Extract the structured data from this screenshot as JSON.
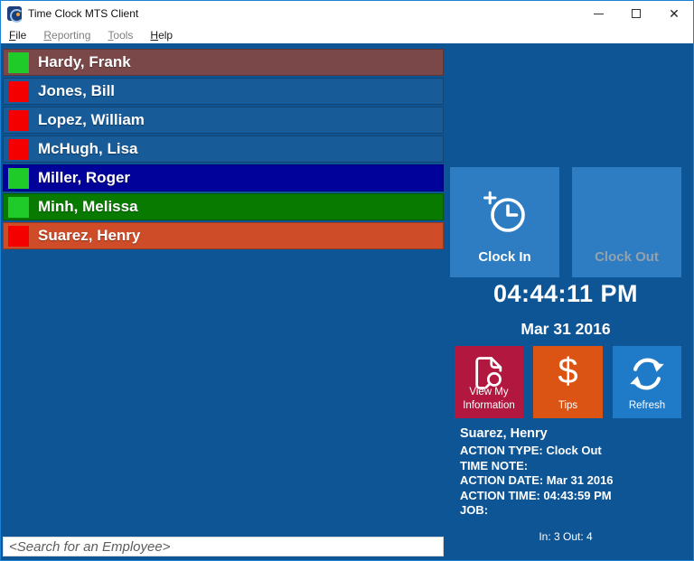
{
  "window": {
    "title": "Time Clock MTS Client",
    "controls": {
      "minimize": "minimize",
      "maximize": "maximize",
      "close": "close"
    }
  },
  "menu": {
    "items": [
      {
        "label": "File",
        "enabled": true
      },
      {
        "label": "Reporting",
        "enabled": false
      },
      {
        "label": "Tools",
        "enabled": false
      },
      {
        "label": "Help",
        "enabled": true
      }
    ]
  },
  "employees": [
    {
      "name": "Hardy, Frank",
      "status": "in",
      "indicator_color": "#1ECB29",
      "row_color": "#7A4848"
    },
    {
      "name": "Jones, Bill",
      "status": "out",
      "indicator_color": "#F40000",
      "row_color": "#175B99"
    },
    {
      "name": "Lopez, William",
      "status": "out",
      "indicator_color": "#F40000",
      "row_color": "#175B99"
    },
    {
      "name": "McHugh, Lisa",
      "status": "out",
      "indicator_color": "#F40000",
      "row_color": "#175B99"
    },
    {
      "name": "Miller, Roger",
      "status": "in",
      "indicator_color": "#1ECB29",
      "row_color": "#000299"
    },
    {
      "name": "Minh, Melissa",
      "status": "in",
      "indicator_color": "#1ECB29",
      "row_color": "#087A00"
    },
    {
      "name": "Suarez, Henry",
      "status": "out",
      "indicator_color": "#F40000",
      "row_color": "#CE4C28"
    }
  ],
  "actions": {
    "clock_in_label": "Clock In",
    "clock_out_label": "Clock Out",
    "clock_out_enabled": false
  },
  "clock": {
    "time": "04:44:11 PM",
    "date": "Mar 31 2016"
  },
  "tiles": [
    {
      "label": "View My Information",
      "color": "#B2173F",
      "icon": "document-search-icon"
    },
    {
      "label": "Tips",
      "color": "#DC5414",
      "icon": "dollar-icon"
    },
    {
      "label": "Refresh",
      "color": "#1F7AC8",
      "icon": "refresh-icon"
    }
  ],
  "last_action": {
    "employee": "Suarez, Henry",
    "lines": [
      "ACTION TYPE: Clock Out",
      "TIME NOTE:",
      "ACTION DATE: Mar 31 2016",
      "ACTION TIME: 04:43:59 PM",
      "JOB:"
    ]
  },
  "search": {
    "placeholder": "<Search for an Employee>"
  },
  "status_bar": {
    "in_out": "In: 3 Out: 4"
  },
  "icons": {
    "dollar": "$"
  },
  "colors": {
    "window_accent": "#1B82D6",
    "content_bg": "#0E5596",
    "big_tile_blue": "#2E7DC2",
    "clock_out_disabled_text": "#93A1AC",
    "row_default_blue": "#175B99",
    "in_indicator_green": "#1ECB29",
    "out_indicator_red": "#F40000"
  }
}
